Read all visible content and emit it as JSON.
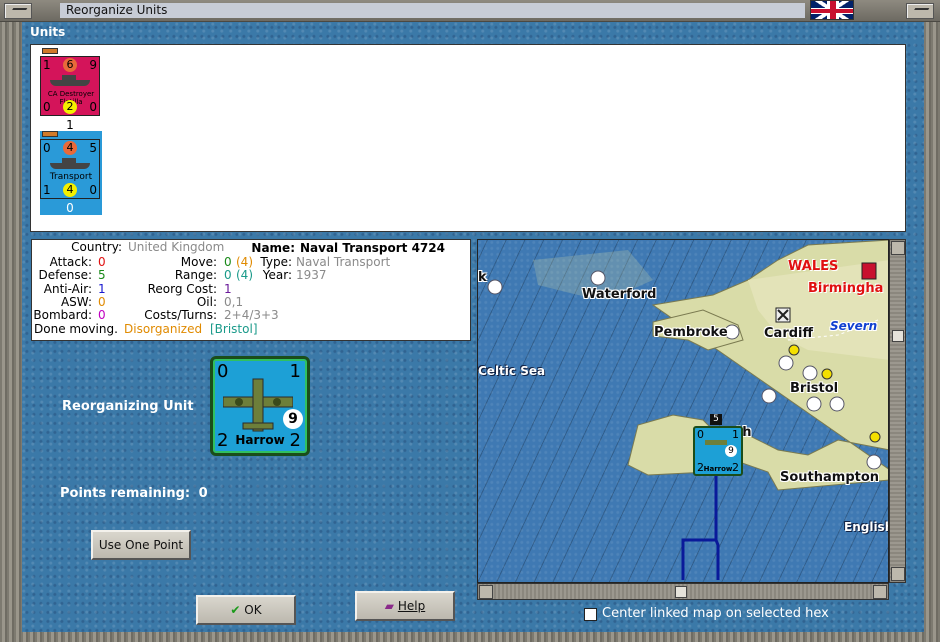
{
  "window": {
    "title": "Reorganize Units"
  },
  "units_section": {
    "label": "Units"
  },
  "units": [
    {
      "tl": "1",
      "tc": "6",
      "tr": "9",
      "bl": "0",
      "bc": "2",
      "br": "0",
      "name": "CA Destroyer Flotilla",
      "below": "1",
      "color": "#d4145a"
    },
    {
      "tl": "0",
      "tc": "4",
      "tr": "5",
      "bl": "1",
      "bc": "4",
      "br": "0",
      "name": "Transport",
      "below": "0",
      "color": "#2a9ad8"
    }
  ],
  "info": {
    "country_label": "Country:",
    "country": "United Kingdom",
    "name_label": "Name:",
    "name": "Naval Transport 4724",
    "attack_label": "Attack:",
    "attack": "0",
    "move_label": "Move:",
    "move": "0",
    "move_max": "(4)",
    "type_label": "Type:",
    "type": "Naval Transport",
    "defense_label": "Defense:",
    "defense": "5",
    "range_label": "Range:",
    "range": "0",
    "range_max": "(4)",
    "year_label": "Year:",
    "year": "1937",
    "antiair_label": "Anti-Air:",
    "antiair": "1",
    "reorg_label": "Reorg Cost:",
    "reorg": "1",
    "asw_label": "ASW:",
    "asw": "0",
    "oil_label": "Oil:",
    "oil": "0,1",
    "bombard_label": "Bombard:",
    "bombard": "0",
    "costs_label": "Costs/Turns:",
    "costs": "2+4/3+3",
    "status_text": "Done moving.",
    "status_org": "Disorganized",
    "status_loc": "[Bristol]"
  },
  "reorganizing": {
    "label": "Reorganizing Unit",
    "unit": {
      "tl": "0",
      "tr": "1",
      "bl": "2",
      "br": "2",
      "badge": "9",
      "name": "Harrow"
    }
  },
  "points": {
    "label": "Points remaining:",
    "value": "0"
  },
  "buttons": {
    "use_one_point": "Use One Point",
    "ok": "OK",
    "help": "Help"
  },
  "map": {
    "places": [
      "Waterford",
      "Pembroke",
      "Cardiff",
      "Bristol",
      "Southampton",
      "WALES",
      "Birmingha",
      "Severn",
      "Celtic Sea",
      "English",
      "k",
      "th"
    ],
    "map_unit": {
      "tl": "0",
      "tr": "1",
      "bl": "2",
      "br": "2",
      "badge": "9",
      "name": "Harrow",
      "stack": "5"
    }
  },
  "center_map": {
    "label": "Center linked map on selected hex",
    "checked": false
  },
  "colors": {
    "attack": "#e01010",
    "defense": "#1a8a1a",
    "antiair": "#1a1ad0",
    "asw": "#e08a00",
    "bombard": "#c000c0",
    "disorganized": "#e08a00",
    "location": "#1a9a8a"
  }
}
